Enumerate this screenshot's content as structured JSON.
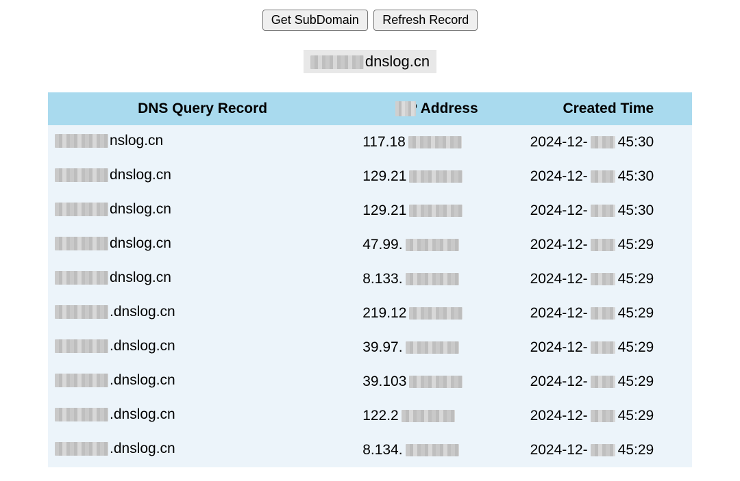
{
  "buttons": {
    "get_subdomain": "Get SubDomain",
    "refresh_record": "Refresh Record"
  },
  "subdomain": {
    "prefix_masked": true,
    "suffix": "dnslog.cn"
  },
  "table": {
    "headers": {
      "dns_query_record": "DNS Query Record",
      "ip_address": "IP Address",
      "created_time": "Created Time"
    },
    "rows": [
      {
        "domain_suffix": "nslog.cn",
        "ip_prefix": "117.18",
        "time_prefix": "2024-12-",
        "time_suffix": "45:30"
      },
      {
        "domain_suffix": "dnslog.cn",
        "ip_prefix": "129.21",
        "time_prefix": "2024-12-",
        "time_suffix": "45:30"
      },
      {
        "domain_suffix": "dnslog.cn",
        "ip_prefix": "129.21",
        "time_prefix": "2024-12-",
        "time_suffix": "45:30"
      },
      {
        "domain_suffix": "dnslog.cn",
        "ip_prefix": "47.99.",
        "time_prefix": "2024-12-",
        "time_suffix": "45:29"
      },
      {
        "domain_suffix": "dnslog.cn",
        "ip_prefix": "8.133.",
        "time_prefix": "2024-12-",
        "time_suffix": "45:29"
      },
      {
        "domain_suffix": ".dnslog.cn",
        "ip_prefix": "219.12",
        "time_prefix": "2024-12-",
        "time_suffix": "45:29"
      },
      {
        "domain_suffix": ".dnslog.cn",
        "ip_prefix": "39.97.",
        "time_prefix": "2024-12-",
        "time_suffix": "45:29"
      },
      {
        "domain_suffix": ".dnslog.cn",
        "ip_prefix": "39.103",
        "time_prefix": "2024-12-",
        "time_suffix": "45:29"
      },
      {
        "domain_suffix": ".dnslog.cn",
        "ip_prefix": "122.2",
        "time_prefix": "2024-12-",
        "time_suffix": "45:29"
      },
      {
        "domain_suffix": ".dnslog.cn",
        "ip_prefix": "8.134.",
        "time_prefix": "2024-12-",
        "time_suffix": "45:29"
      }
    ]
  }
}
